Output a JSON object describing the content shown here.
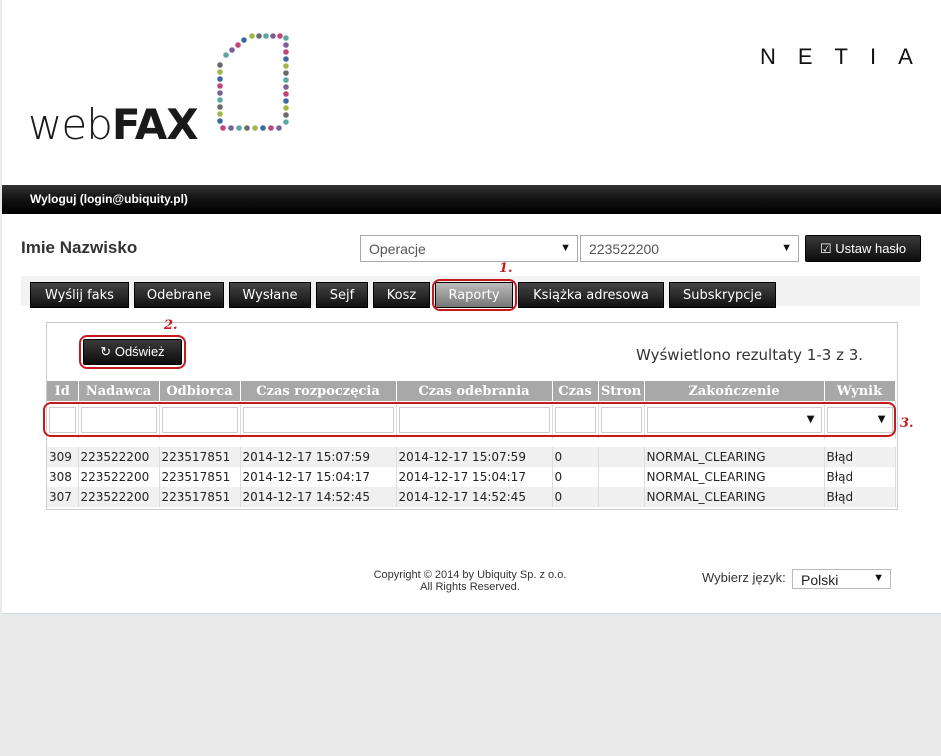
{
  "header": {
    "logo_text_light": "web",
    "logo_text_bold": "FAX",
    "brand_right": "NETIA",
    "logo_dot_colors": [
      "#5aa9a0",
      "#7a5f9a",
      "#c0457a",
      "#3b6aa0",
      "#a0b84a",
      "#6a6a6a"
    ]
  },
  "topbar": {
    "logout_label": "Wyloguj (login@ubiquity.pl)"
  },
  "user": {
    "name": "Imie Nazwisko"
  },
  "controls": {
    "operation_select": "Operacje",
    "number_select": "223522200",
    "set_password_label": "Ustaw hasło"
  },
  "tabs": [
    {
      "label": "Wyślij faks"
    },
    {
      "label": "Odebrane"
    },
    {
      "label": "Wysłane"
    },
    {
      "label": "Sejf"
    },
    {
      "label": "Kosz"
    },
    {
      "label": "Raporty",
      "active": true
    },
    {
      "label": "Książka adresowa"
    },
    {
      "label": "Subskrypcje"
    }
  ],
  "panel": {
    "refresh_label": "Odśwież",
    "results_text": "Wyświetlono rezultaty 1-3 z 3."
  },
  "table": {
    "columns": [
      "Id",
      "Nadawca",
      "Odbiorca",
      "Czas rozpoczęcia",
      "Czas odebrania",
      "Czas",
      "Stron",
      "Zakończenie",
      "Wynik"
    ],
    "rows": [
      [
        "309",
        "223522200",
        "223517851",
        "2014-12-17 15:07:59",
        "2014-12-17 15:07:59",
        "0",
        "",
        "NORMAL_CLEARING",
        "Błąd"
      ],
      [
        "308",
        "223522200",
        "223517851",
        "2014-12-17 15:04:17",
        "2014-12-17 15:04:17",
        "0",
        "",
        "NORMAL_CLEARING",
        "Błąd"
      ],
      [
        "307",
        "223522200",
        "223517851",
        "2014-12-17 14:52:45",
        "2014-12-17 14:52:45",
        "0",
        "",
        "NORMAL_CLEARING",
        "Błąd"
      ]
    ]
  },
  "annotations": [
    "1.",
    "2.",
    "3."
  ],
  "footer": {
    "copyright_line1": "Copyright © 2014 by Ubiquity Sp. z o.o.",
    "copyright_line2": "All Rights Reserved.",
    "language_label": "Wybierz język:",
    "language_value": "Polski"
  },
  "colors": {
    "annotation": "#c41a20",
    "header_bar": "#111111",
    "table_header": "#a8a8a8"
  }
}
